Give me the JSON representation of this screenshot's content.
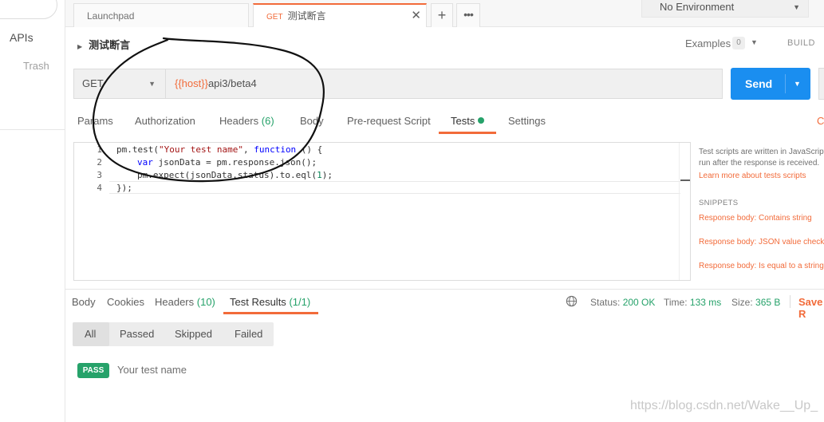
{
  "sidebar": {
    "apis_label": "APIs",
    "trash_label": "Trash"
  },
  "tabs": [
    {
      "label": "Launchpad"
    },
    {
      "method": "GET",
      "label": "测试断言",
      "close": "✕"
    }
  ],
  "tab_actions": {
    "plus": "+",
    "more": "•••"
  },
  "environment": {
    "label": "No Environment"
  },
  "request": {
    "name": "测试断言",
    "examples_label": "Examples",
    "examples_count": "0",
    "build_label": "BUILD",
    "method": "GET",
    "url_var": "{{host}}",
    "url_rest": "api3/beta4",
    "send_label": "Send"
  },
  "request_tabs": [
    {
      "label": "Params",
      "count": ""
    },
    {
      "label": "Authorization",
      "count": ""
    },
    {
      "label": "Headers",
      "count": "(6)"
    },
    {
      "label": "Body",
      "count": ""
    },
    {
      "label": "Pre-request Script",
      "count": ""
    },
    {
      "label": "Tests",
      "count": ""
    },
    {
      "label": "Settings",
      "count": ""
    }
  ],
  "cookies_cut": "Co",
  "editor": {
    "line_numbers": [
      "1",
      "2",
      "3",
      "4"
    ],
    "code": {
      "l1_a": "pm.test(",
      "l1_str": "\"Your test name\"",
      "l1_b": ", ",
      "l1_kw": "function",
      "l1_c": " () {",
      "l2_kw": "var",
      "l2_rest": " jsonData = pm.response.json();",
      "l3_a": "pm.expect(jsonData.status).to.eql(",
      "l3_num": "1",
      "l3_b": ");",
      "l4": "});"
    }
  },
  "help": {
    "line1": "Test scripts are written in JavaScript",
    "line2": "run after the response is received.",
    "learn_more": "Learn more about tests scripts",
    "snippets_heading": "SNIPPETS",
    "snippets": [
      "Response body: Contains string",
      "Response body: JSON value check",
      "Response body: Is equal to a string"
    ]
  },
  "response_tabs": [
    {
      "label": "Body",
      "count": ""
    },
    {
      "label": "Cookies",
      "count": ""
    },
    {
      "label": "Headers",
      "count": "(10)"
    },
    {
      "label": "Test Results",
      "count": "(1/1)"
    }
  ],
  "response_status": {
    "status_label": "Status:",
    "status_value": "200 OK",
    "time_label": "Time:",
    "time_value": "133 ms",
    "size_label": "Size:",
    "size_value": "365 B",
    "save_label": "Save R"
  },
  "filters": [
    "All",
    "Passed",
    "Skipped",
    "Failed"
  ],
  "results": [
    {
      "badge": "PASS",
      "name": "Your test name"
    }
  ],
  "watermark": "https://blog.csdn.net/Wake__Up_",
  "colors": {
    "accent": "#f26b3a",
    "send": "#1a8ef0",
    "pass": "#26a26a"
  }
}
